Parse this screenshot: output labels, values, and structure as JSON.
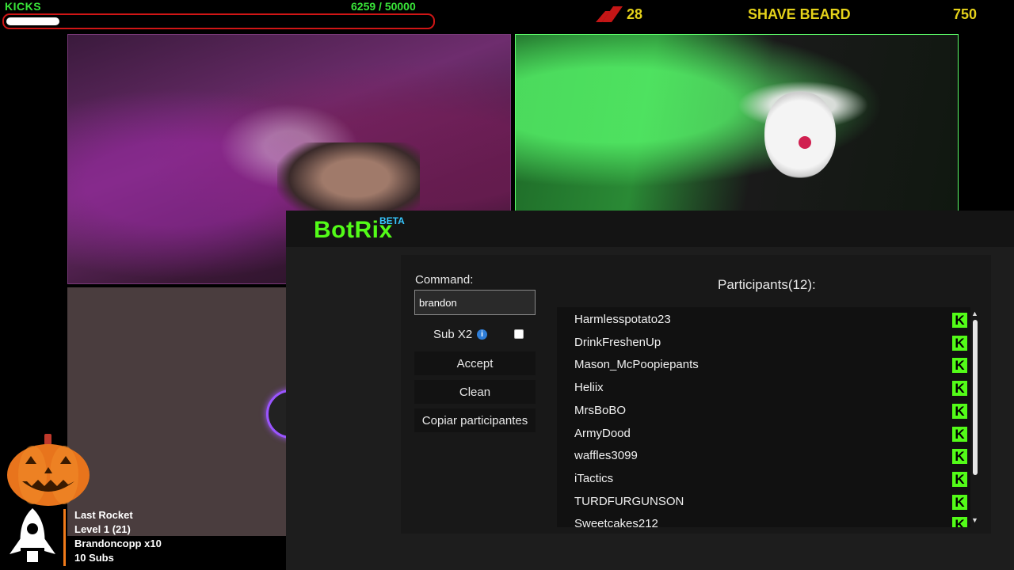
{
  "hud": {
    "kicks_label": "KICKS",
    "kicks_count": "6259  / 50000",
    "kicks_progress": 0.125,
    "goal_count": "28",
    "goal_title": "SHAVE BEARD",
    "goal_target": "750",
    "accent_color": "#39e639",
    "goal_color": "#e5d21a"
  },
  "botrix": {
    "logo": "BotRix",
    "beta": "BETA",
    "command_label": "Command:",
    "command_value": "brandon",
    "sub_label": "Sub X2",
    "sub_checked": false,
    "accept_label": "Accept",
    "clean_label": "Clean",
    "copy_label": "Copiar participantes",
    "participants_title": "Participants(12):",
    "participants": [
      "Harmlesspotato23",
      "DrinkFreshenUp",
      "Mason_McPoopiepants",
      "Heliix",
      "MrsBoBO",
      "ArmyDood",
      "waffles3099",
      "iTactics",
      "TURDFURGUNSON",
      "Sweetcakes212"
    ],
    "brand_color": "#53fc18",
    "kick_icon_glyph": "K"
  },
  "rocket_widget": {
    "line1": "Last Rocket",
    "line2": "Level 1  (21)",
    "line3": "Brandoncopp x10",
    "line4": "10 Subs"
  },
  "icons": {
    "info": "info-icon",
    "kick": "kick-logo-icon",
    "pumpkin": "jack-o-lantern-icon",
    "rocket": "rocket-icon"
  }
}
